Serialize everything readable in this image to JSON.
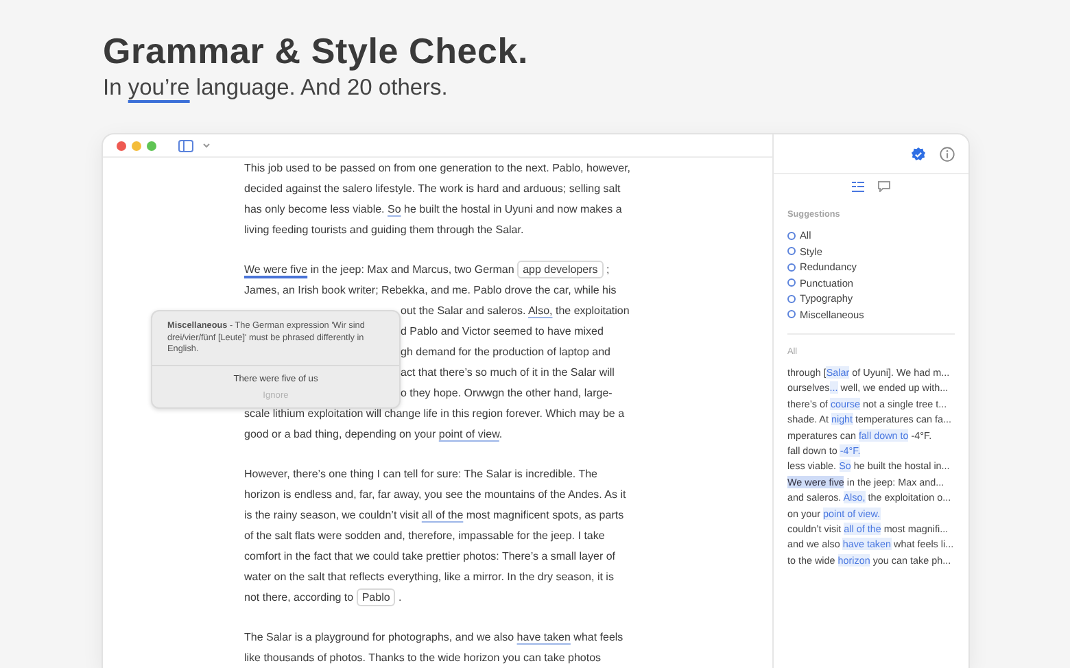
{
  "headline": {
    "title": "Grammar & Style Check.",
    "subtitle": [
      {
        "text": "In ",
        "kind": "plain"
      },
      {
        "text": "you’re",
        "kind": "flag"
      },
      {
        "text": " language. And 20 others.",
        "kind": "plain"
      }
    ]
  },
  "editor": {
    "paragraphs": [
      {
        "lines": [
          {
            "segments": [
              {
                "text": "This job used to be passed on from one generation to the next. Pablo, however,",
                "kind": "plain"
              }
            ]
          },
          {
            "segments": [
              {
                "text": "decided against the salero lifestyle. The work is hard and arduous; selling salt",
                "kind": "plain"
              }
            ]
          },
          {
            "segments": [
              {
                "text": "has only become less viable. ",
                "kind": "plain"
              },
              {
                "text": "So",
                "kind": "flag"
              },
              {
                "text": " he built the hostal in Uyuni and now makes a",
                "kind": "plain"
              }
            ]
          },
          {
            "segments": [
              {
                "text": "living feeding tourists and guiding them through the Salar.",
                "kind": "plain"
              }
            ]
          }
        ]
      },
      {
        "lines": [
          {
            "segments": [
              {
                "text": "We were five",
                "kind": "active"
              },
              {
                "text": " in the jeep: Max and Marcus, two German ",
                "kind": "plain"
              },
              {
                "text": "app developers",
                "kind": "chip"
              },
              {
                "text": " ;",
                "kind": "plain"
              }
            ]
          },
          {
            "segments": [
              {
                "text": "James, an Irish book writer; Rebekka, and me. Pablo drove the car, while his",
                "kind": "plain"
              }
            ]
          }
        ],
        "lines_beside_popup": [
          {
            "segments": [
              {
                "text": "out the Salar and saleros. ",
                "kind": "plain"
              },
              {
                "text": "Also,",
                "kind": "flag"
              },
              {
                "text": " the exploitation",
                "kind": "plain"
              }
            ]
          },
          {
            "segments": [
              {
                "text": "d Pablo and Victor seemed to have mixed",
                "kind": "plain"
              }
            ]
          },
          {
            "segments": [
              {
                "text": "gh demand for the production of laptop and",
                "kind": "plain"
              }
            ]
          },
          {
            "segments": [
              {
                "text": "act that there’s so much of it in the Salar will",
                "kind": "plain"
              }
            ]
          },
          {
            "segments": [
              {
                "text": "o they hope. Orwwgn the other hand, large-",
                "kind": "plain"
              }
            ]
          }
        ],
        "lines_after_popup": [
          {
            "segments": [
              {
                "text": "scale lithium exploitation will change life in this region forever. Which may be a",
                "kind": "plain"
              }
            ]
          },
          {
            "segments": [
              {
                "text": "good or a bad thing, depending on your ",
                "kind": "plain"
              },
              {
                "text": "point of view",
                "kind": "flag"
              },
              {
                "text": ".",
                "kind": "plain"
              }
            ]
          }
        ]
      },
      {
        "lines": [
          {
            "segments": [
              {
                "text": "However, there’s one thing I can tell for sure: The Salar is incredible. The",
                "kind": "plain"
              }
            ]
          },
          {
            "segments": [
              {
                "text": "horizon is endless and, far, far away, you see the mountains of the Andes. As it",
                "kind": "plain"
              }
            ]
          },
          {
            "segments": [
              {
                "text": "is the rainy season, we couldn’t visit ",
                "kind": "plain"
              },
              {
                "text": "all of the",
                "kind": "flag"
              },
              {
                "text": " most magnificent spots, as parts",
                "kind": "plain"
              }
            ]
          },
          {
            "segments": [
              {
                "text": "of the salt flats were sodden and, therefore, impassable for the jeep. I take",
                "kind": "plain"
              }
            ]
          },
          {
            "segments": [
              {
                "text": "comfort in the fact that we could take prettier photos: There’s a small layer of",
                "kind": "plain"
              }
            ]
          },
          {
            "segments": [
              {
                "text": "water on the salt that reflects everything, like a mirror. In the dry season, it is",
                "kind": "plain"
              }
            ]
          },
          {
            "segments": [
              {
                "text": "not there, according to ",
                "kind": "plain"
              },
              {
                "text": "Pablo",
                "kind": "chip"
              },
              {
                "text": " .",
                "kind": "plain"
              }
            ]
          }
        ]
      },
      {
        "lines": [
          {
            "segments": [
              {
                "text": "The Salar is a playground for photographs, and we also ",
                "kind": "plain"
              },
              {
                "text": "have taken",
                "kind": "flag"
              },
              {
                "text": " what feels",
                "kind": "plain"
              }
            ]
          },
          {
            "segments": [
              {
                "text": "like thousands of photos. Thanks to the wide horizon you can take photos",
                "kind": "plain"
              }
            ]
          }
        ]
      }
    ]
  },
  "popup": {
    "category": "Miscellaneous",
    "message": " - The German expression 'Wir sind drei/vier/fünf [Leute]' must be phrased differently in English.",
    "suggestion": "There were five of us",
    "ignore": "Ignore"
  },
  "sidebar": {
    "tabs": [
      {
        "kind": "list",
        "selected": true
      },
      {
        "kind": "comment",
        "selected": false
      }
    ],
    "suggestions_title": "Suggestions",
    "categories": [
      "All",
      "Style",
      "Redundancy",
      "Punctuation",
      "Typography",
      "Miscellaneous"
    ],
    "list_title": "All",
    "items": [
      {
        "selected": false,
        "segments": [
          {
            "text": "through [",
            "kind": "plain"
          },
          {
            "text": "Salar",
            "kind": "hit"
          },
          {
            "text": " of Uyuni]. We had m...",
            "kind": "plain"
          }
        ]
      },
      {
        "selected": false,
        "segments": [
          {
            "text": "ourselves",
            "kind": "plain"
          },
          {
            "text": "...",
            "kind": "hit"
          },
          {
            "text": " well, we ended up with...",
            "kind": "plain"
          }
        ]
      },
      {
        "selected": false,
        "segments": [
          {
            "text": "there’s of ",
            "kind": "plain"
          },
          {
            "text": "course",
            "kind": "hit"
          },
          {
            "text": " not a single tree t...",
            "kind": "plain"
          }
        ]
      },
      {
        "selected": false,
        "segments": [
          {
            "text": "shade. At ",
            "kind": "plain"
          },
          {
            "text": "night",
            "kind": "hit"
          },
          {
            "text": " temperatures can fa...",
            "kind": "plain"
          }
        ]
      },
      {
        "selected": false,
        "segments": [
          {
            "text": "mperatures can ",
            "kind": "plain"
          },
          {
            "text": "fall down to",
            "kind": "hit"
          },
          {
            "text": " -4°F.",
            "kind": "plain"
          }
        ]
      },
      {
        "selected": false,
        "segments": [
          {
            "text": "fall down to ",
            "kind": "plain"
          },
          {
            "text": "-4°F.",
            "kind": "hit"
          }
        ]
      },
      {
        "selected": false,
        "segments": [
          {
            "text": "less viable. ",
            "kind": "plain"
          },
          {
            "text": "So",
            "kind": "hit"
          },
          {
            "text": " he built the hostal in...",
            "kind": "plain"
          }
        ]
      },
      {
        "selected": true,
        "segments": [
          {
            "text": "We were five",
            "kind": "hit"
          },
          {
            "text": " in the jeep: Max and...",
            "kind": "plain"
          }
        ]
      },
      {
        "selected": false,
        "segments": [
          {
            "text": "and saleros. ",
            "kind": "plain"
          },
          {
            "text": "Also,",
            "kind": "hit"
          },
          {
            "text": " the exploitation o...",
            "kind": "plain"
          }
        ]
      },
      {
        "selected": false,
        "segments": [
          {
            "text": "on your ",
            "kind": "plain"
          },
          {
            "text": "point of view.",
            "kind": "hit"
          }
        ]
      },
      {
        "selected": false,
        "segments": [
          {
            "text": "couldn’t visit ",
            "kind": "plain"
          },
          {
            "text": "all of the",
            "kind": "hit"
          },
          {
            "text": " most magnifi...",
            "kind": "plain"
          }
        ]
      },
      {
        "selected": false,
        "segments": [
          {
            "text": "and we also ",
            "kind": "plain"
          },
          {
            "text": "have taken",
            "kind": "hit"
          },
          {
            "text": " what feels li...",
            "kind": "plain"
          }
        ]
      },
      {
        "selected": false,
        "segments": [
          {
            "text": "to the wide ",
            "kind": "plain"
          },
          {
            "text": "horizon",
            "kind": "hit"
          },
          {
            "text": " you can take ph...",
            "kind": "plain"
          }
        ]
      }
    ]
  }
}
